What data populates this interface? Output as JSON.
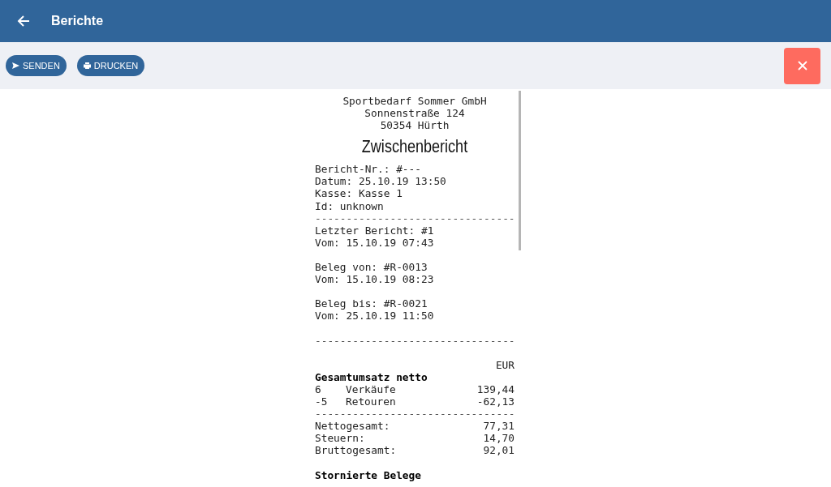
{
  "app_bar": {
    "title": "Berichte"
  },
  "toolbar": {
    "buttons": [
      {
        "kind": "send",
        "label": "SENDEN"
      },
      {
        "kind": "print",
        "label": "DRUCKEN"
      }
    ]
  },
  "receipt": {
    "header": [
      "Sportbedarf Sommer GmbH",
      "Sonnenstraße 124",
      "50354 Hürth"
    ],
    "title": "Zwischenbericht",
    "lines": [
      {
        "kind": "text",
        "text": "Bericht-Nr.: #---"
      },
      {
        "kind": "text",
        "text": "Datum: 25.10.19 13:50"
      },
      {
        "kind": "text",
        "text": "Kasse: Kasse 1"
      },
      {
        "kind": "text",
        "text": "Id: unknown"
      },
      {
        "kind": "rule",
        "text": "--------------------------------"
      },
      {
        "kind": "text",
        "text": "Letzter Bericht: #1"
      },
      {
        "kind": "text",
        "text": "Vom: 15.10.19 07:43"
      },
      {
        "kind": "blank"
      },
      {
        "kind": "text",
        "text": "Beleg von: #R-0013"
      },
      {
        "kind": "text",
        "text": "Vom: 15.10.19 08:23"
      },
      {
        "kind": "blank"
      },
      {
        "kind": "text",
        "text": "Beleg bis: #R-0021"
      },
      {
        "kind": "text",
        "text": "Vom: 25.10.19 11:50"
      },
      {
        "kind": "blank"
      },
      {
        "kind": "rule",
        "text": "--------------------------------"
      },
      {
        "kind": "blank"
      },
      {
        "kind": "right",
        "text": "EUR"
      },
      {
        "kind": "heading",
        "text": "Gesamtumsatz netto"
      },
      {
        "kind": "item",
        "qty": "6",
        "label": "Verkäufe",
        "amount": "139,44"
      },
      {
        "kind": "item",
        "qty": "-5",
        "label": "Retouren",
        "amount": "-62,13"
      },
      {
        "kind": "rule",
        "text": "--------------------------------"
      },
      {
        "kind": "total",
        "label": "Nettogesamt:",
        "amount": "77,31"
      },
      {
        "kind": "total",
        "label": "Steuern:",
        "amount": "14,70"
      },
      {
        "kind": "total",
        "label": "Bruttogesamt:",
        "amount": "92,01"
      },
      {
        "kind": "blank"
      },
      {
        "kind": "heading",
        "text": "Stornierte Belege"
      }
    ]
  }
}
